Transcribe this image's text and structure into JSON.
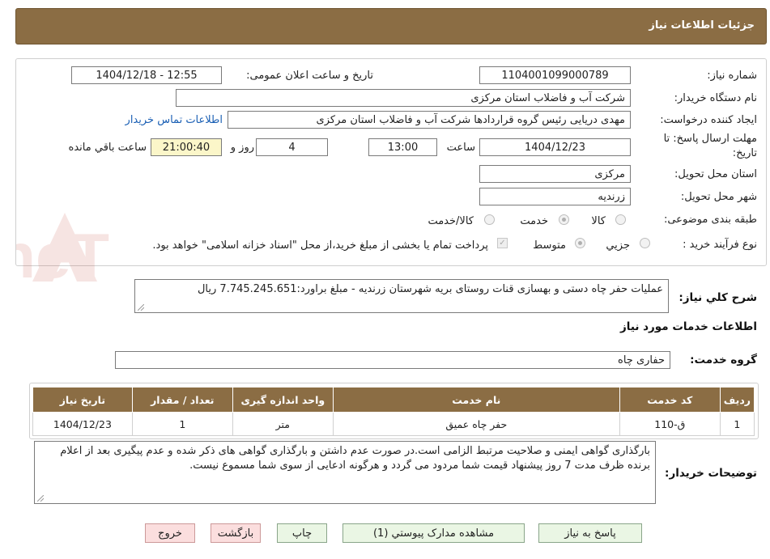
{
  "header": {
    "title": "جزئیات اطلاعات نیاز"
  },
  "form": {
    "need_number_label": "شماره نیاز:",
    "need_number": "1104001099000789",
    "announce_label": "تاریخ و ساعت اعلان عمومی:",
    "announce_value": "1404/12/18 - 12:55",
    "buyer_org_label": "نام دستگاه خریدار:",
    "buyer_org": "شرکت آب و فاضلاب استان مرکزی",
    "creator_label": "ایجاد کننده درخواست:",
    "creator": "مهدی دریایی رئیس گروه قراردادها شرکت آب و فاضلاب استان مرکزی",
    "contact_link": "اطلاعات تماس خریدار",
    "deadline_label_1": "مهلت ارسال پاسخ: تا",
    "deadline_label_2": "تاریخ:",
    "deadline_date": "1404/12/23",
    "time_label": "ساعت",
    "deadline_time": "13:00",
    "days_value": "4",
    "days_label": "روز و",
    "remaining_time": "21:00:40",
    "remaining_label": "ساعت باقي مانده",
    "province_label": "استان محل تحویل:",
    "province": "مرکزی",
    "city_label": "شهر محل تحویل:",
    "city": "زرندیه",
    "category_label": "طبقه بندی موضوعی:",
    "category_options": [
      "کالا",
      "خدمت",
      "کالا/خدمت"
    ],
    "category_selected": "خدمت",
    "process_label": "نوع فرآیند خرید :",
    "process_options": [
      "جزیي",
      "متوسط"
    ],
    "process_selected": "متوسط",
    "treasury_note": "پرداخت تمام یا بخشی از مبلغ خرید،از محل \"اسناد خزانه اسلامی\" خواهد بود."
  },
  "description": {
    "label": "شرح کلي نياز:",
    "text": "عملیات حفر چاه دستی  و بهسازی قنات روستای بریه  شهرستان زرندیه - مبلغ براورد:7.745.245.651 ریال"
  },
  "services": {
    "section_title": "اطلاعات خدمات مورد نياز",
    "group_label": "گروه خدمت:",
    "group_value": "حفاری چاه",
    "columns": [
      "رديف",
      "کد خدمت",
      "نام خدمت",
      "واحد اندازه گيری",
      "تعداد / مقدار",
      "تاريخ نياز"
    ],
    "rows": [
      [
        "1",
        "ق-110",
        "حفر چاه عمیق",
        "متر",
        "1",
        "1404/12/23"
      ]
    ]
  },
  "buyer_notes": {
    "label": "توضيحات خريدار:",
    "text": "بارگذاری گواهی ایمنی و صلاحیت مرتبط الزامی است.در صورت عدم داشتن و بارگذاری گواهی های ذکر شده و عدم پیگیری بعد از اعلام برنده ظرف مدت 7 روز پیشنهاد قیمت شما مردود می گردد و هرگونه ادعایی از سوی شما مسموع نیست."
  },
  "buttons": {
    "reply": "پاسخ به نياز",
    "attachments": "مشاهده مدارک پيوستي (1)",
    "print": "چاپ",
    "back": "بازگشت",
    "exit": "خروج"
  },
  "watermark": {
    "text": "AnaTender.neT",
    "color": "#c0392b"
  },
  "colors": {
    "header": "#8b6d44",
    "link": "#1a5fb4",
    "button": "#eaf6e4",
    "button_red": "#fbdede"
  }
}
